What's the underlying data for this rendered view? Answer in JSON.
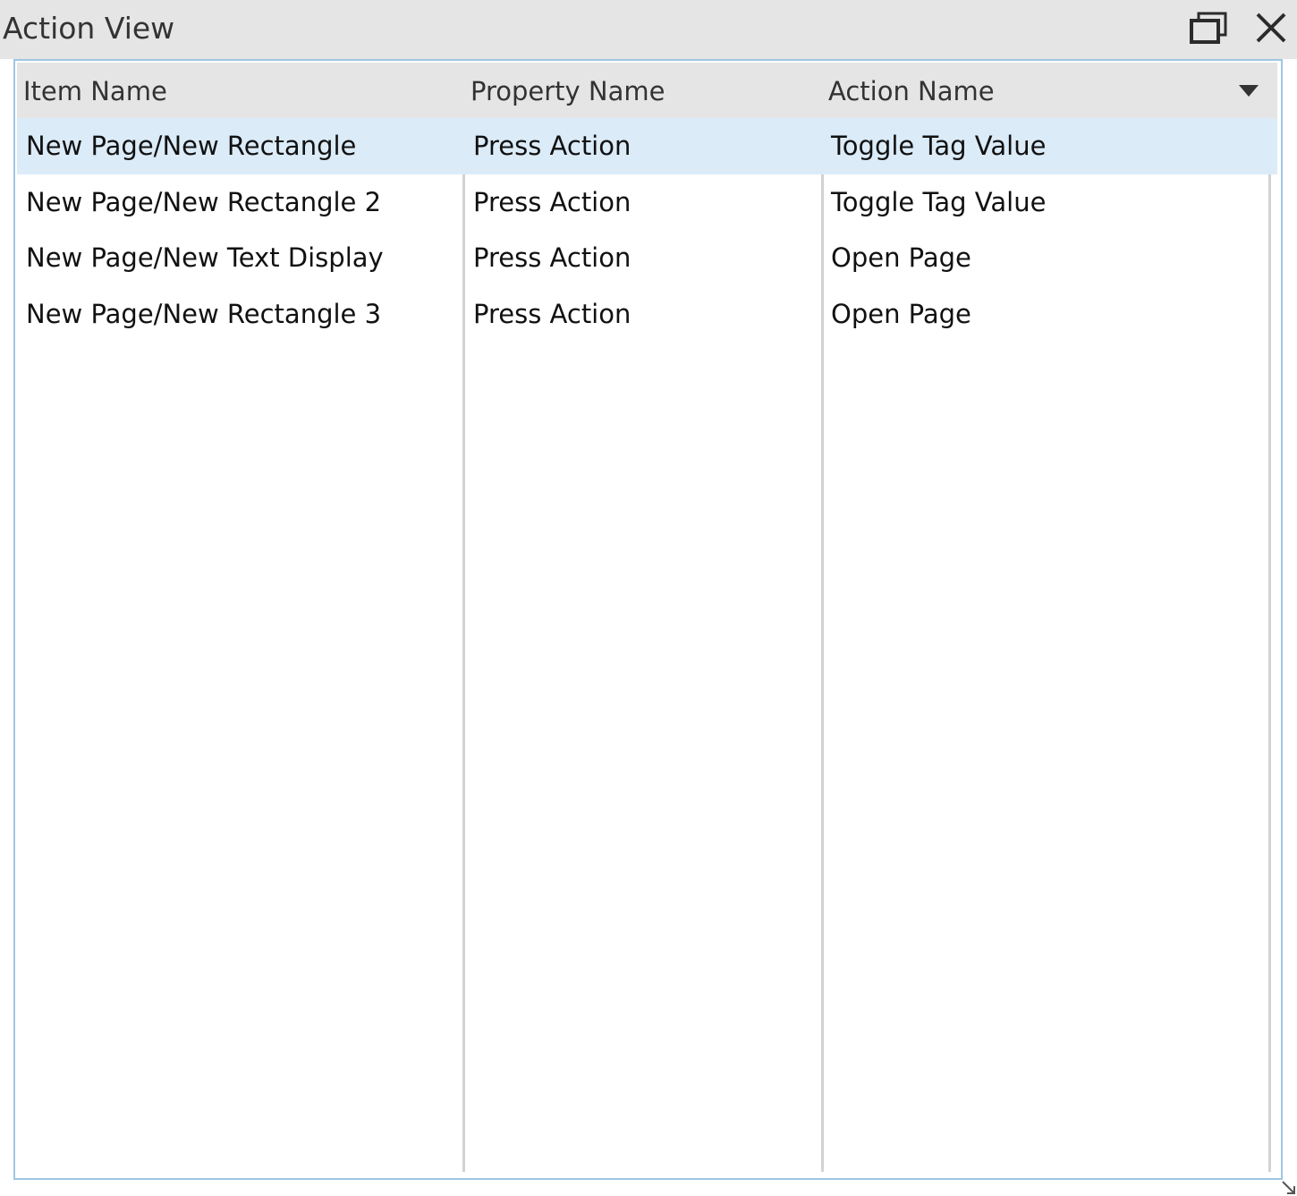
{
  "window": {
    "title": "Action View"
  },
  "icons": {
    "restore": "restore-window-icon",
    "close": "close-icon",
    "sort": "sort-down-triangle-icon",
    "resize": "resize-grip-icon"
  },
  "colors": {
    "title_bar": "#e5e5e5",
    "header": "#e5e5e5",
    "panel_border": "#9fc6e2",
    "selected_row": "#dbebf8",
    "divider": "#d2d2d2"
  },
  "table": {
    "columns": [
      "Item Name",
      "Property Name",
      "Action Name"
    ],
    "rows": [
      {
        "item": "New Page/New Rectangle",
        "property": "Press Action",
        "action": "Toggle Tag Value",
        "selected": true
      },
      {
        "item": "New Page/New Rectangle 2",
        "property": "Press Action",
        "action": "Toggle Tag Value",
        "selected": false
      },
      {
        "item": "New Page/New Text Display",
        "property": "Press Action",
        "action": "Open Page",
        "selected": false
      },
      {
        "item": "New Page/New Rectangle 3",
        "property": "Press Action",
        "action": "Open Page",
        "selected": false
      }
    ]
  }
}
